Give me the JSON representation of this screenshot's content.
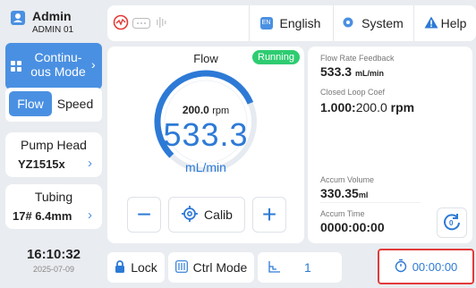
{
  "user": {
    "name": "Admin",
    "id": "ADMIN 01"
  },
  "sidebar": {
    "mode_label_line1": "Continu-",
    "mode_label_line2": "ous Mode",
    "flow_label": "Flow",
    "speed_label": "Speed",
    "pump_head_title": "Pump Head",
    "pump_head_value": "YZ1515x",
    "tubing_title": "Tubing",
    "tubing_value": "17# 6.4mm",
    "time": "16:10:32",
    "date": "2025-07-09"
  },
  "topbar": {
    "language": "English",
    "language_badge": "EN",
    "system": "System",
    "help": "Help"
  },
  "flow_panel": {
    "title": "Flow",
    "status": "Running",
    "rpm_value": "200.0",
    "rpm_unit": "rpm",
    "flow_value": "533.3",
    "flow_unit": "mL/min",
    "calib_label": "Calib",
    "minus_symbol": "−",
    "plus_symbol": "+",
    "dial_fraction": 0.75
  },
  "info_panel": {
    "flow_feedback_label": "Flow Rate Feedback",
    "flow_feedback_value": "533.3",
    "flow_feedback_unit": "mL/min",
    "closed_loop_label": "Closed Loop Coef",
    "closed_loop_value_a": "1.000",
    "closed_loop_sep": ":",
    "closed_loop_value_b": "200.0",
    "closed_loop_unit": "rpm",
    "accum_volume_label": "Accum Volume",
    "accum_volume_value": "330.35",
    "accum_volume_unit": "ml",
    "accum_time_label": "Accum Time",
    "accum_time_value": "0000:00:00"
  },
  "bottombar": {
    "lock_label": "Lock",
    "ctrl_mode_label": "Ctrl Mode",
    "step_value": "1",
    "timer_value": "00:00:00"
  },
  "colors": {
    "accent": "#4a90e2",
    "dial_blue": "#2d7ad6",
    "running_green": "#2ecc71",
    "highlight_red": "#e23b3b",
    "status_red": "#e53935"
  }
}
